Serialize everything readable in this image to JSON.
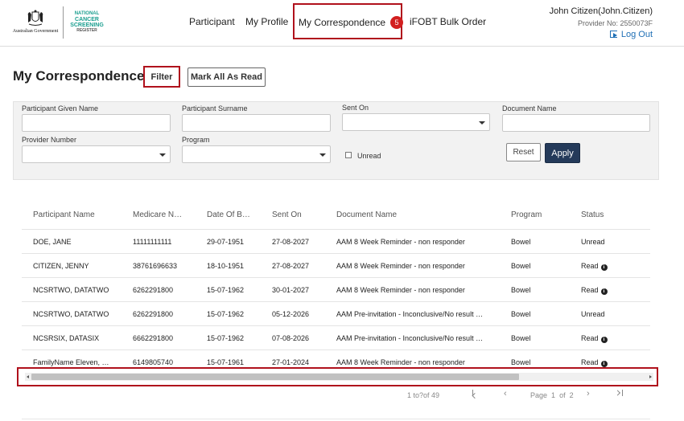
{
  "logos": {
    "gov_text": "Australian Government",
    "ncsr_line1": "NATIONAL",
    "ncsr_line2": "CANCER",
    "ncsr_line3": "SCREENING",
    "ncsr_line4": "REGISTER"
  },
  "nav": {
    "participant": "Participant",
    "my_profile": "My Profile",
    "my_correspondence": "My Correspondence",
    "correspondence_badge": "5",
    "ifobt": "iFOBT Bulk Order"
  },
  "user": {
    "name": "John Citizen(John.Citizen)",
    "provider_no": "Provider No: 2550073F",
    "logout": "Log Out"
  },
  "page": {
    "title": "My Correspondence",
    "filter_button": "Filter",
    "mark_all_button": "Mark All As Read"
  },
  "filters": {
    "given_name_label": "Participant Given Name",
    "surname_label": "Participant Surname",
    "sent_on_label": "Sent On",
    "document_name_label": "Document Name",
    "provider_number_label": "Provider Number",
    "program_label": "Program",
    "unread_label": "Unread",
    "reset_button": "Reset",
    "apply_button": "Apply"
  },
  "table": {
    "headers": [
      "Participant Name",
      "Medicare N…",
      "Date Of B…",
      "Sent On",
      "Document Name",
      "Program",
      "Status"
    ],
    "rows": [
      [
        "DOE, JANE",
        "11111111111",
        "29-07-1951",
        "27-08-2027",
        "AAM 8 Week Reminder - non responder",
        "Bowel",
        "Unread"
      ],
      [
        "CITIZEN, JENNY",
        "38761696633",
        "18-10-1951",
        "27-08-2027",
        "AAM 8 Week Reminder - non responder",
        "Bowel",
        "Read"
      ],
      [
        "NCSRTWO, DATATWO",
        "6262291800",
        "15-07-1962",
        "30-01-2027",
        "AAM 8 Week Reminder - non responder",
        "Bowel",
        "Read"
      ],
      [
        "NCSRTWO, DATATWO",
        "6262291800",
        "15-07-1962",
        "05-12-2026",
        "AAM Pre-invitation - Inconclusive/No result …",
        "Bowel",
        "Unread"
      ],
      [
        "NCSRSIX, DATASIX",
        "6662291800",
        "15-07-1962",
        "07-08-2026",
        "AAM Pre-invitation - Inconclusive/No result …",
        "Bowel",
        "Read"
      ],
      [
        "FamilyName Eleven, …",
        "6149805740",
        "15-07-1961",
        "27-01-2024",
        "AAM 8 Week Reminder - non responder",
        "Bowel",
        "Read"
      ]
    ]
  },
  "pagination": {
    "count": "1 to?of 49",
    "page_label": "Page",
    "current_page": "1",
    "of_label": "of",
    "total_pages": "2"
  },
  "colors": {
    "highlight": "#b0111c",
    "apply": "#243a5a",
    "link": "#1f6fb5",
    "badge": "#d21f1f"
  }
}
